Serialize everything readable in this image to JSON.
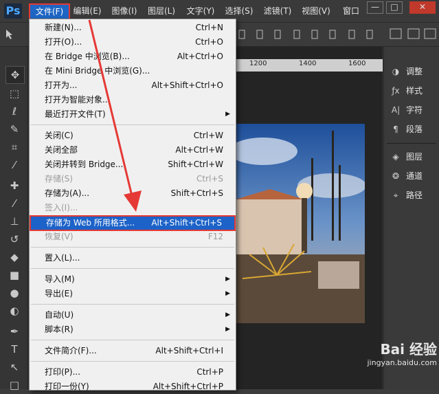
{
  "app": {
    "logo_text": "Ps"
  },
  "menubar": [
    {
      "label": "文件(F)"
    },
    {
      "label": "编辑(E)"
    },
    {
      "label": "图像(I)"
    },
    {
      "label": "图层(L)"
    },
    {
      "label": "文字(Y)"
    },
    {
      "label": "选择(S)"
    },
    {
      "label": "滤镜(T)"
    },
    {
      "label": "视图(V)"
    },
    {
      "label": "窗口"
    }
  ],
  "window_controls": {
    "minimize": "—",
    "maximize": "□",
    "close": "✕"
  },
  "ruler": {
    "labels": [
      "1200",
      "1400",
      "1600"
    ]
  },
  "file_menu": [
    {
      "label": "新建(N)...",
      "shortcut": "Ctrl+N",
      "disabled": false
    },
    {
      "label": "打开(O)...",
      "shortcut": "Ctrl+O",
      "disabled": false
    },
    {
      "label": "在 Bridge 中浏览(B)...",
      "shortcut": "Alt+Ctrl+O",
      "disabled": false
    },
    {
      "label": "在 Mini Bridge 中浏览(G)...",
      "shortcut": "",
      "disabled": false
    },
    {
      "label": "打开为...",
      "shortcut": "Alt+Shift+Ctrl+O",
      "disabled": false
    },
    {
      "label": "打开为智能对象...",
      "shortcut": "",
      "disabled": false
    },
    {
      "label": "最近打开文件(T)",
      "shortcut": "",
      "disabled": false,
      "submenu": true
    },
    {
      "label": "关闭(C)",
      "shortcut": "Ctrl+W",
      "disabled": false
    },
    {
      "label": "关闭全部",
      "shortcut": "Alt+Ctrl+W",
      "disabled": false
    },
    {
      "label": "关闭并转到 Bridge...",
      "shortcut": "Shift+Ctrl+W",
      "disabled": false
    },
    {
      "label": "存储(S)",
      "shortcut": "Ctrl+S",
      "disabled": true
    },
    {
      "label": "存储为(A)...",
      "shortcut": "Shift+Ctrl+S",
      "disabled": false
    },
    {
      "label": "签入(I)...",
      "shortcut": "",
      "disabled": true
    },
    {
      "label": "存储为 Web 所用格式...",
      "shortcut": "Alt+Shift+Ctrl+S",
      "disabled": false,
      "highlighted": true
    },
    {
      "label": "恢复(V)",
      "shortcut": "F12",
      "disabled": true
    },
    {
      "label": "置入(L)...",
      "shortcut": "",
      "disabled": false
    },
    {
      "label": "导入(M)",
      "shortcut": "",
      "disabled": false,
      "submenu": true
    },
    {
      "label": "导出(E)",
      "shortcut": "",
      "disabled": false,
      "submenu": true
    },
    {
      "label": "自动(U)",
      "shortcut": "",
      "disabled": false,
      "submenu": true
    },
    {
      "label": "脚本(R)",
      "shortcut": "",
      "disabled": false,
      "submenu": true
    },
    {
      "label": "文件简介(F)...",
      "shortcut": "Alt+Shift+Ctrl+I",
      "disabled": false
    },
    {
      "label": "打印(P)...",
      "shortcut": "Ctrl+P",
      "disabled": false
    },
    {
      "label": "打印一份(Y)",
      "shortcut": "Alt+Shift+Ctrl+P",
      "disabled": false
    }
  ],
  "panels": [
    {
      "label": "调整",
      "icon": "adjustments-icon"
    },
    {
      "label": "样式",
      "icon": "styles-icon"
    },
    {
      "label": "字符",
      "icon": "character-icon"
    },
    {
      "label": "段落",
      "icon": "paragraph-icon"
    },
    {
      "label": "图层",
      "icon": "layers-icon"
    },
    {
      "label": "通道",
      "icon": "channels-icon"
    },
    {
      "label": "路径",
      "icon": "paths-icon"
    }
  ],
  "watermark": {
    "line1": "Bai 经验",
    "line2": "jingyan.baidu.com"
  },
  "colors": {
    "highlight": "#1c62c8",
    "annotation_red": "#e53935"
  }
}
